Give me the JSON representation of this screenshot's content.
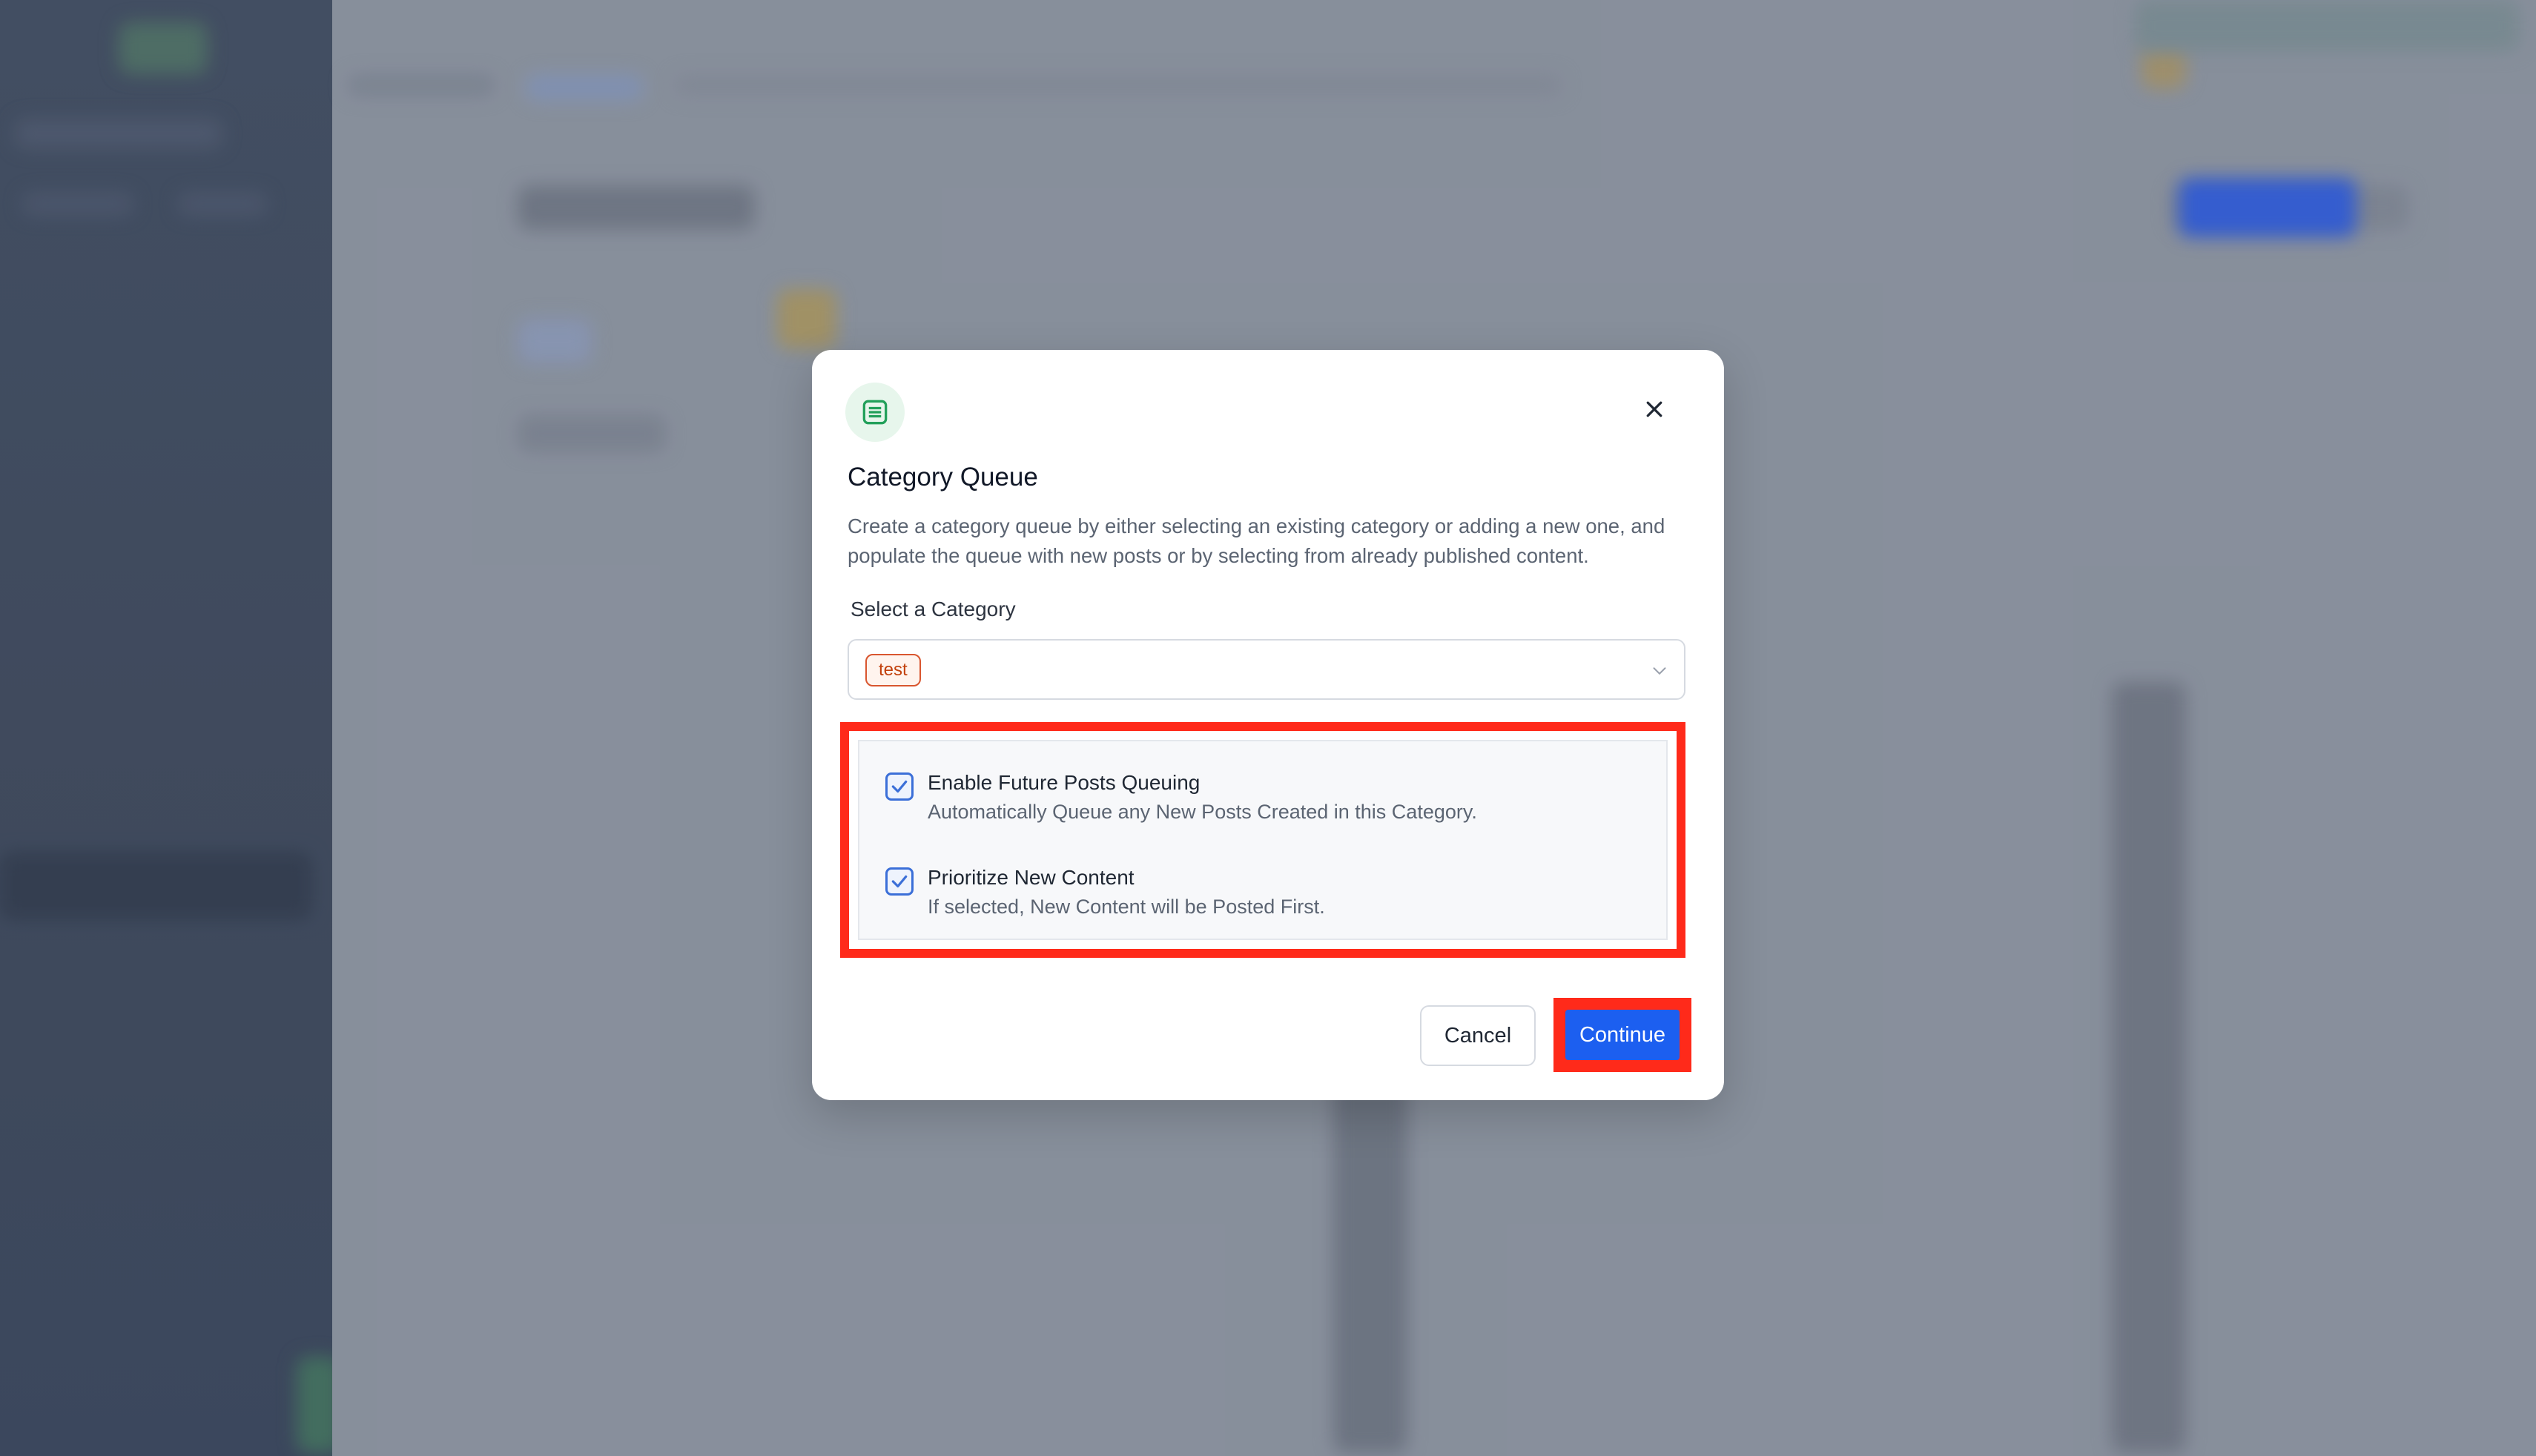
{
  "modal": {
    "icon": "list-document-icon",
    "title": "Category Queue",
    "description": "Create a category queue by either selecting an existing category or adding a new one, and populate the queue with new posts or by selecting from already published content.",
    "close_icon": "close-icon",
    "category_label": "Select a Category",
    "selected_tag": "test",
    "options": [
      {
        "title": "Enable Future Posts Queuing",
        "subtitle": "Automatically Queue any New Posts Created in this Category.",
        "checked": true
      },
      {
        "title": "Prioritize New Content",
        "subtitle": "If selected, New Content will be Posted First.",
        "checked": true
      }
    ],
    "cancel_label": "Cancel",
    "continue_label": "Continue"
  },
  "colors": {
    "accent": "#1c5ff0",
    "highlight": "#ff2a1a",
    "tag_border": "#d9562f",
    "icon_green": "#22a05a"
  }
}
